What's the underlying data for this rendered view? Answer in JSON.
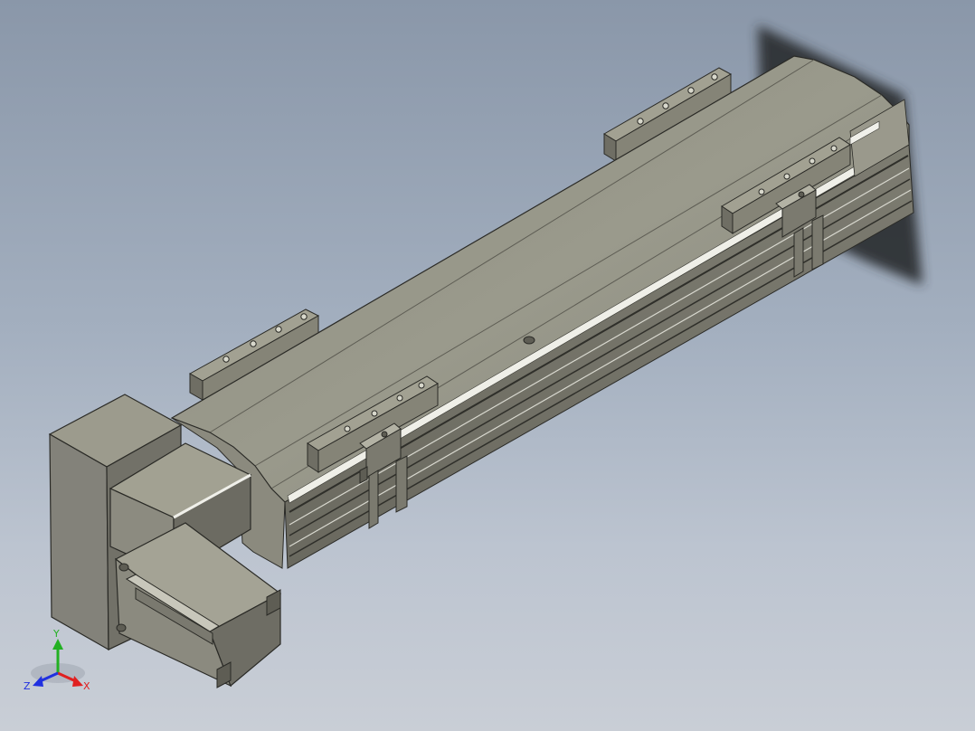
{
  "viewport": {
    "background_top": "#8a97a9",
    "background_bottom": "#c9ced6"
  },
  "model": {
    "body_color": "#8f8e80",
    "shadow_color": "#2d3034"
  },
  "triad": {
    "x_label": "X",
    "y_label": "Y",
    "z_label": "Z",
    "x_color": "#e02020",
    "y_color": "#22b022",
    "z_color": "#2030e0"
  }
}
